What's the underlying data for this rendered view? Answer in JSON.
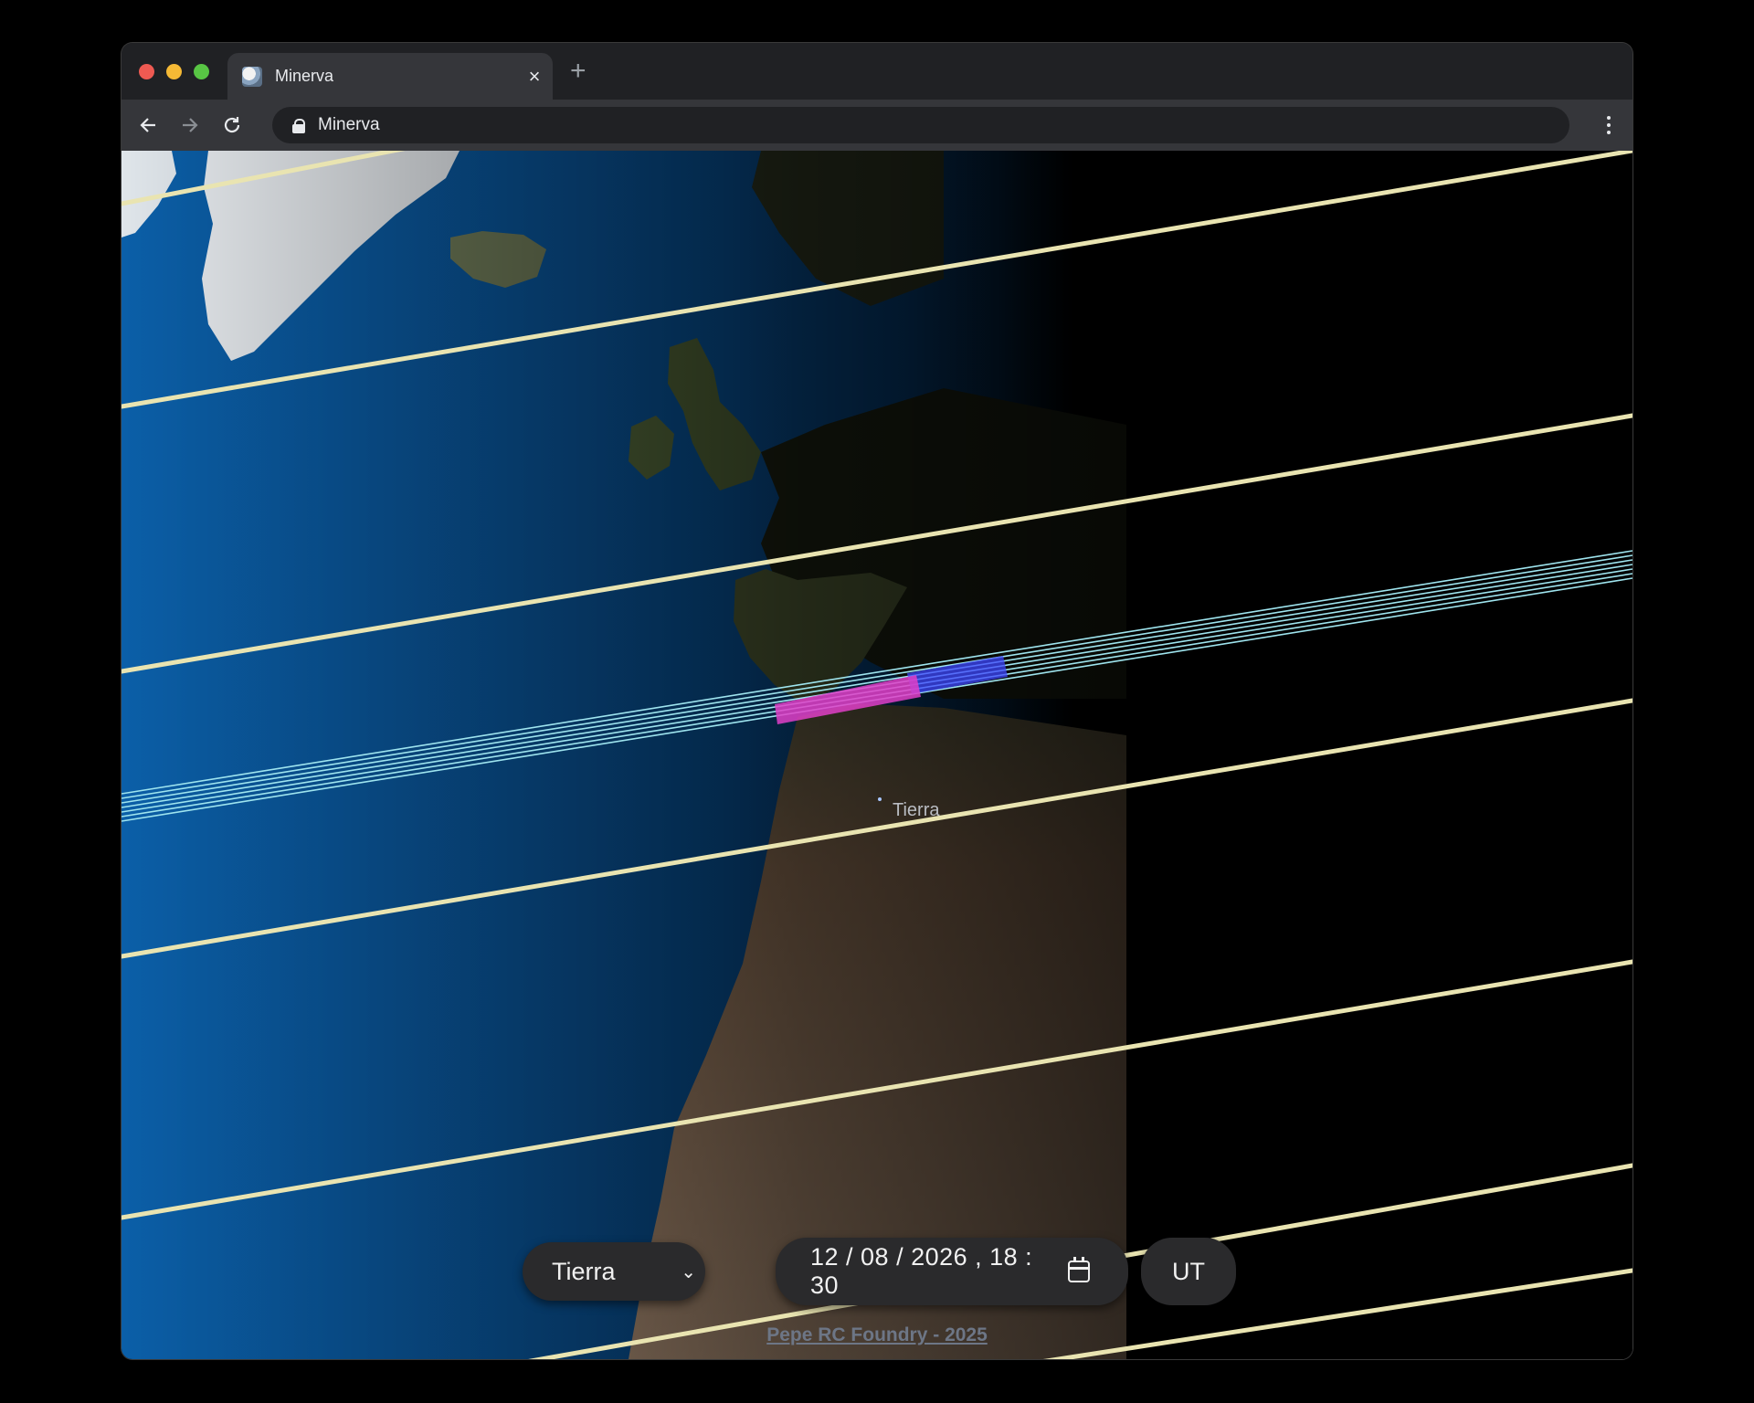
{
  "browser": {
    "tab_title": "Minerva",
    "address": "Minerva",
    "close_glyph": "×",
    "newtab_glyph": "+",
    "icons": [
      "back-arrow-icon",
      "forward-arrow-icon",
      "reload-icon",
      "lock-icon",
      "menu-icon",
      "close-icon"
    ]
  },
  "map": {
    "earth_label": "Tierra",
    "colors": {
      "ocean": "#0d4c86",
      "land": "#5b6b3e",
      "desert": "#9a7b5e",
      "ice": "#e7ecef",
      "night": "#000000",
      "orbit_track": "#e9e4b1",
      "pass_track": "#9fe5ef",
      "pass_highlight": "#e040c8",
      "pass_blue": "#3e47ff"
    }
  },
  "controls": {
    "body_select": {
      "value": "Tierra",
      "chevron": "⌄"
    },
    "datetime": {
      "value": "12 / 08 / 2026 ,  18 : 30"
    },
    "timezone_button": "UT"
  },
  "footer": {
    "credit": "Pepe RC Foundry - 2025"
  }
}
